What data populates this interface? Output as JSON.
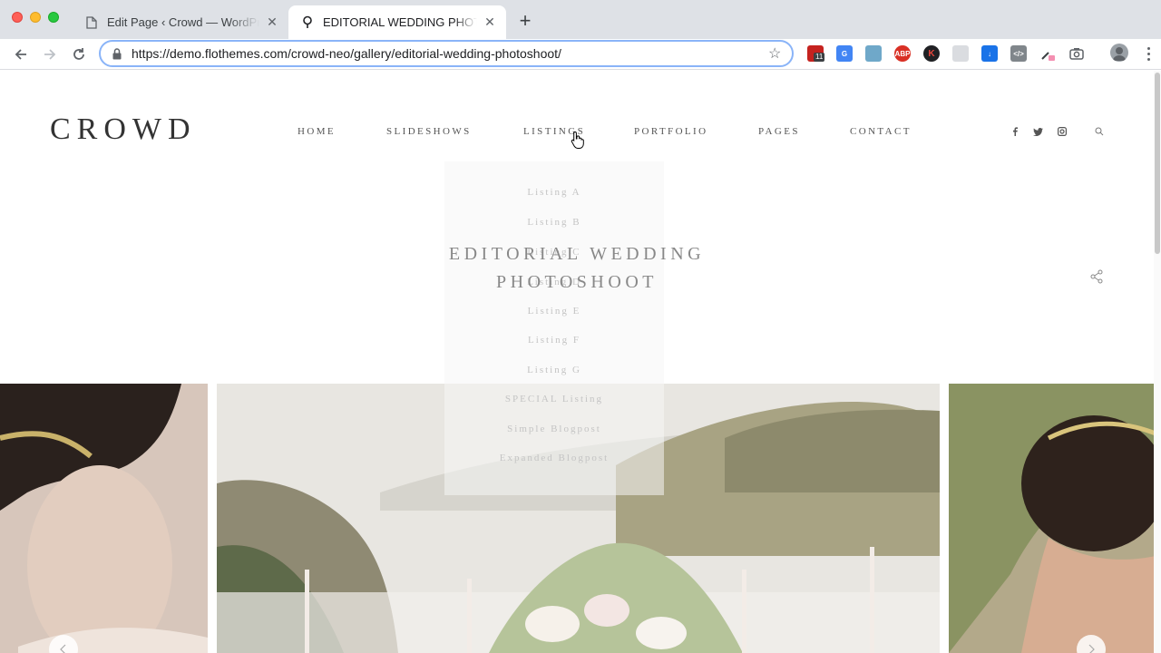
{
  "browser": {
    "tabs": [
      {
        "title": "Edit Page ‹ Crowd — WordPress",
        "icon": "document-icon",
        "active": false
      },
      {
        "title": "EDITORIAL WEDDING PHOTOSHOOT",
        "icon": "location-pin-icon",
        "active": true
      }
    ],
    "url": "https://demo.flothemes.com/crowd-neo/gallery/editorial-wedding-photoshoot/",
    "extensions": [
      "calendar-ext",
      "translate-ext",
      "image-ext",
      "adblock-ext",
      "k-ext",
      "chat-ext",
      "download-ext",
      "code-ext",
      "eyedropper-ext",
      "camera-ext"
    ],
    "calendar_badge": "11",
    "abp_label": "ABP",
    "k_label": "K"
  },
  "site": {
    "logo": "CROWD",
    "nav": [
      {
        "label": "HOME"
      },
      {
        "label": "SLIDESHOWS"
      },
      {
        "label": "LISTINGS"
      },
      {
        "label": "PORTFOLIO"
      },
      {
        "label": "PAGES"
      },
      {
        "label": "CONTACT"
      }
    ],
    "social_icons": [
      "facebook-icon",
      "twitter-icon",
      "instagram-icon",
      "search-icon"
    ],
    "listings_menu": [
      "Listing A",
      "Listing B",
      "Listing C",
      "Listing D",
      "Listing E",
      "Listing F",
      "Listing G",
      "SPECIAL Listing",
      "Simple Blogpost",
      "Expanded Blogpost"
    ],
    "page_title": {
      "line1": "EDITORIAL WEDDING",
      "line2": "PHOTOSHOOT"
    }
  },
  "colors": {
    "tabbar_bg": "#dee1e6",
    "omnibox_focus": "#8ab4f8",
    "text_dark": "#333333",
    "nav_text": "#555555",
    "dropdown_text": "#c4c4c4"
  }
}
